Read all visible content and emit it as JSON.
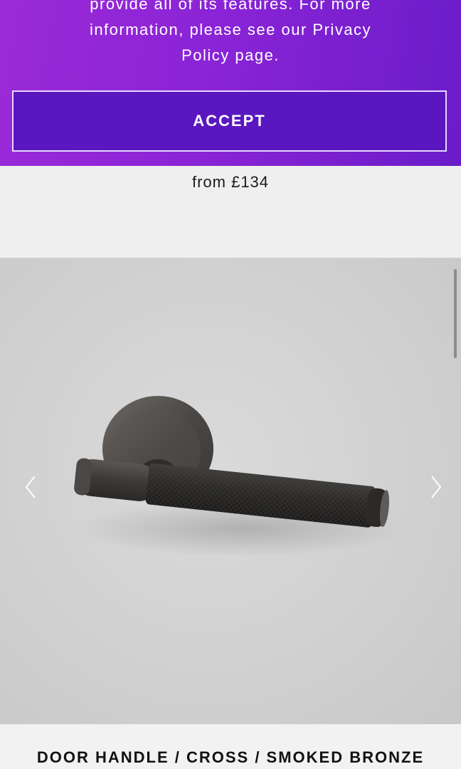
{
  "cookie": {
    "line1": "provide all of its features. For more",
    "line2": "information, please see our Privacy",
    "line3": "Policy page.",
    "accept_label": "ACCEPT"
  },
  "product": {
    "price": "from £134",
    "title": "DOOR HANDLE / CROSS / SMOKED BRONZE"
  },
  "gallery": {
    "prev_icon": "chevron-left-icon",
    "next_icon": "chevron-right-icon"
  }
}
